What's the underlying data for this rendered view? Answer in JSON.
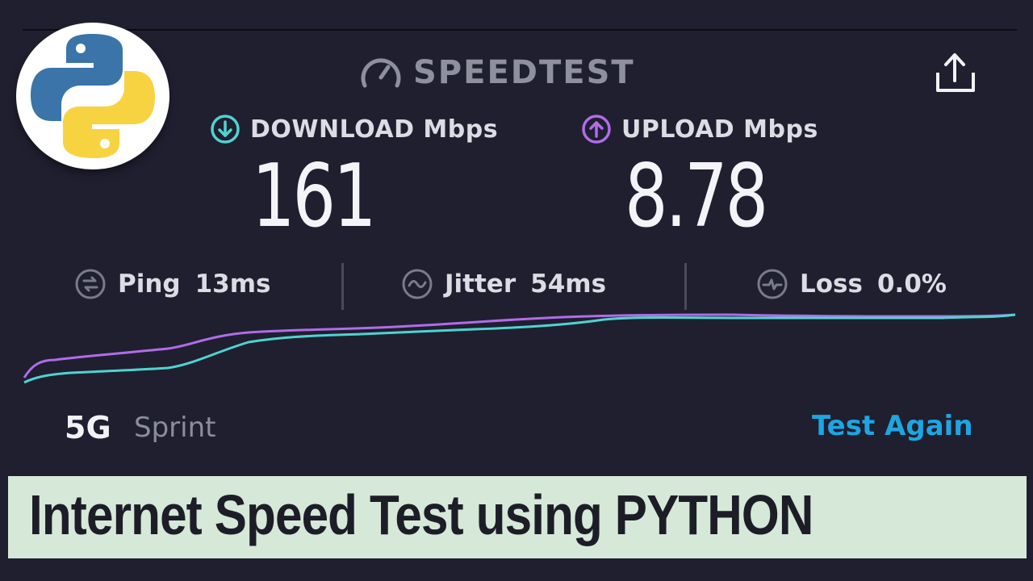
{
  "app": {
    "brand": "SPEEDTEST",
    "brand_icon": "speedometer-icon",
    "share_icon": "share-icon"
  },
  "download": {
    "label": "DOWNLOAD Mbps",
    "value": "161",
    "icon": "download-arrow-icon",
    "color": "#4fd3d0"
  },
  "upload": {
    "label": "UPLOAD Mbps",
    "value": "8.78",
    "icon": "upload-arrow-icon",
    "color": "#b16ce8"
  },
  "stats": {
    "ping": {
      "label": "Ping",
      "value": "13ms",
      "icon": "ping-icon"
    },
    "jitter": {
      "label": "Jitter",
      "value": "54ms",
      "icon": "jitter-icon"
    },
    "loss": {
      "label": "Loss",
      "value": "0.0%",
      "icon": "loss-icon"
    }
  },
  "footer": {
    "network_type": "5G",
    "carrier": "Sprint",
    "test_again_label": "Test Again",
    "accent": "#1ea6e0"
  },
  "caption": {
    "text": "Internet Speed Test using PYTHON"
  },
  "logo": {
    "name": "python-logo",
    "colors": [
      "#3a74a8",
      "#f7d342"
    ]
  }
}
